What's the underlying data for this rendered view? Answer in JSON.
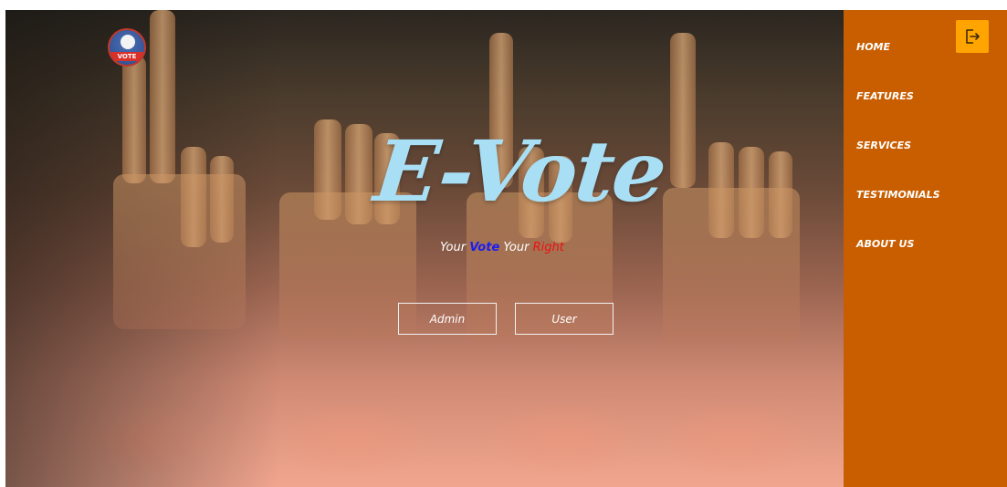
{
  "logo": {
    "text": "VOTE"
  },
  "hero": {
    "title": "E-Vote",
    "tagline": {
      "part1": "Your ",
      "part2": "Vote",
      "part3": " Your ",
      "part4": "Right"
    },
    "buttons": {
      "admin": "Admin",
      "user": "User"
    }
  },
  "sidebar": {
    "logout_icon": "logout-icon",
    "nav": [
      "HOME",
      "FEATURES",
      "SERVICES",
      "TESTIMONIALS",
      "ABOUT US"
    ]
  },
  "colors": {
    "sidebar": "#c95e00",
    "logout_button": "#ffa400",
    "title": "#a8dff5",
    "tagline_vote": "#1c1cf0",
    "tagline_right": "#ee1111"
  }
}
